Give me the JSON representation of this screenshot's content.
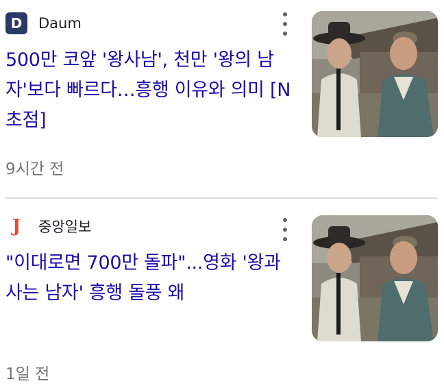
{
  "items": [
    {
      "source": "Daum",
      "logo_letter": "D",
      "headline": "500만 코앞 '왕사남', 천만 '왕의 남자'보다 빠르다…흥행 이유와 의미 [N초점]",
      "time": "9시간 전",
      "thumbnail": "still-two-men-in-traditional-hanbok-icon",
      "more_icon": "more-vert-icon"
    },
    {
      "source": "중앙일보",
      "logo_letter": "J",
      "headline": "\"이대로면 700만 돌파\"...영화 '왕과 사는 남자' 흥행 돌풍 왜",
      "time": "1일 전",
      "thumbnail": "still-two-men-in-traditional-hanbok-icon",
      "more_icon": "more-vert-icon"
    }
  ],
  "colors": {
    "headline": "#1a0dab",
    "meta": "#70757a",
    "daum_logo_bg": "#2a3a68",
    "joongang_logo": "#e8492a",
    "divider": "#dadce0"
  }
}
